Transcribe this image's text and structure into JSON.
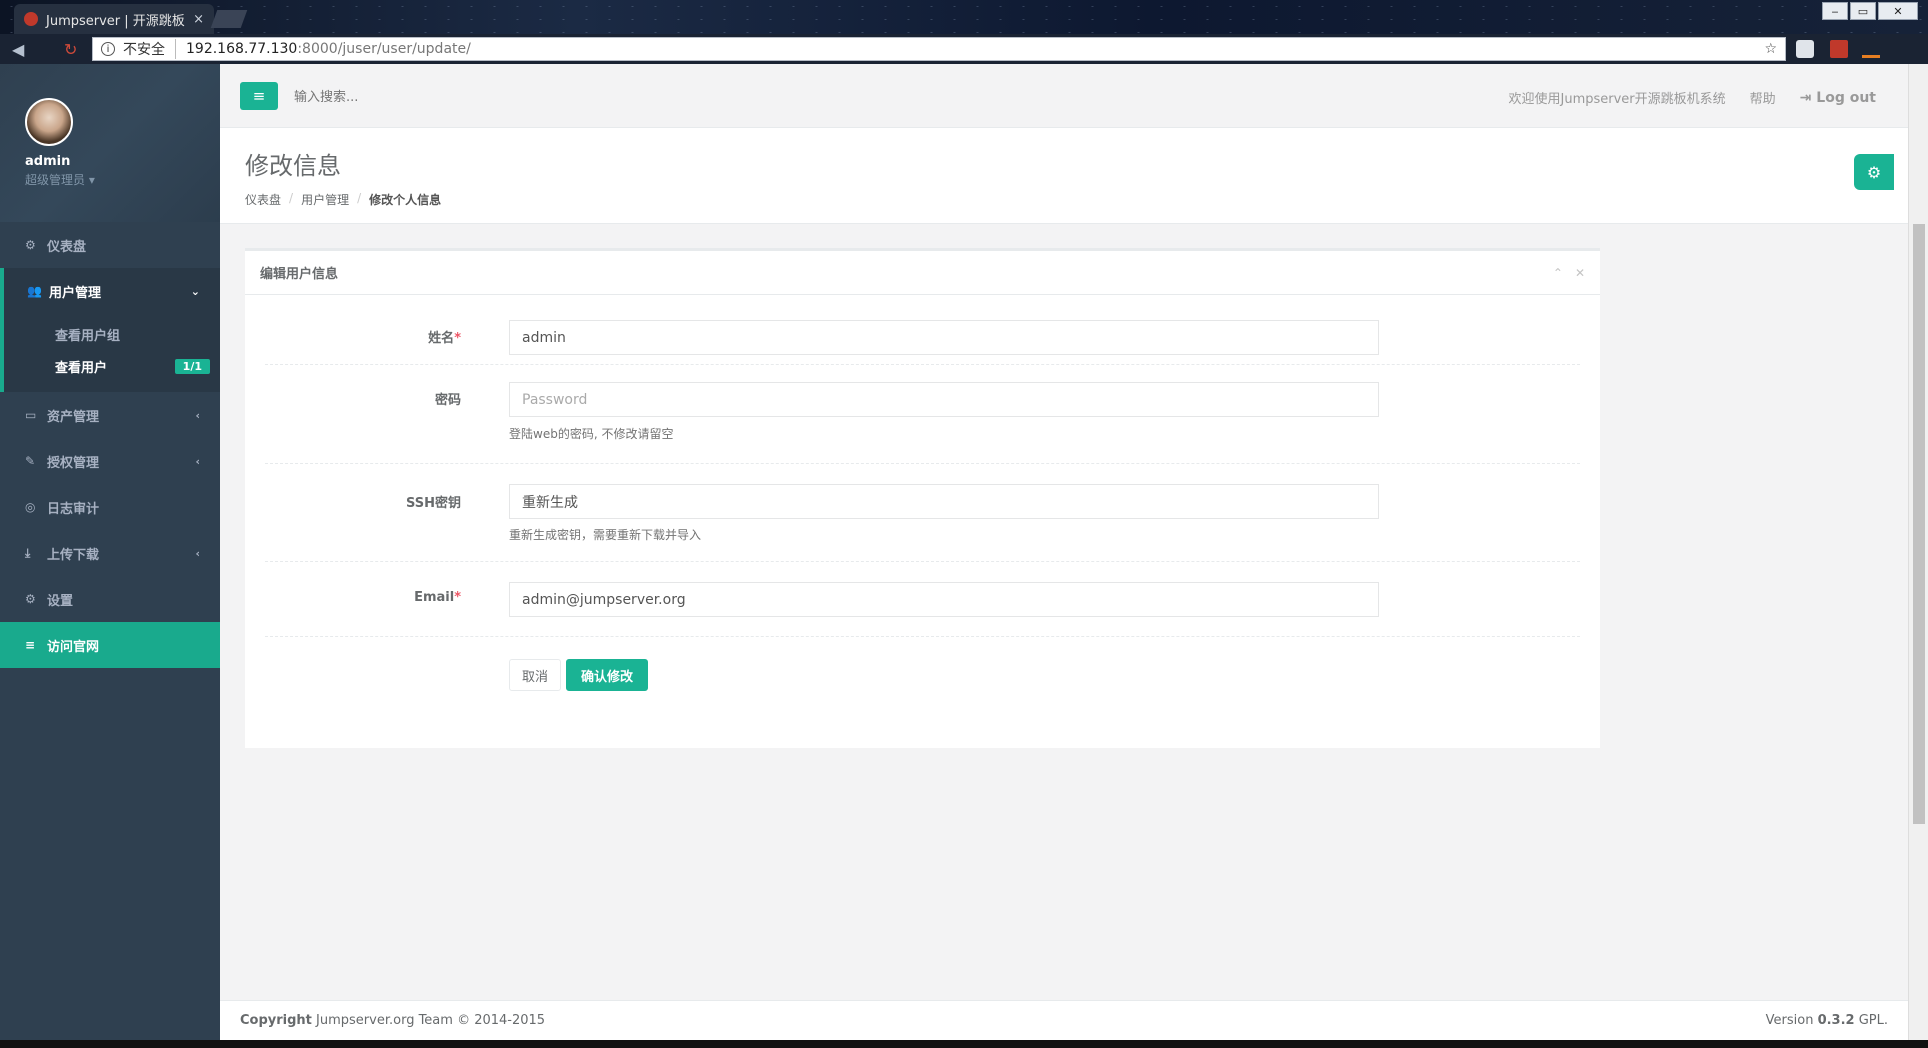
{
  "browser": {
    "tab_title": "Jumpserver | 开源跳板",
    "tab_close": "×",
    "insecure_label": "不安全",
    "url_host": "192.168.77.130",
    "url_path": ":8000/juser/user/update/",
    "win_min": "‒",
    "win_max": "▭",
    "win_close": "✕"
  },
  "sidebar": {
    "username": "admin",
    "role": "超级管理员 ▾",
    "items": [
      {
        "label": "仪表盘",
        "icon": "⚙"
      },
      {
        "label": "用户管理",
        "icon": "👥",
        "arrow": "⌄"
      },
      {
        "label": "资产管理",
        "icon": "▭",
        "arrow": "‹"
      },
      {
        "label": "授权管理",
        "icon": "✎",
        "arrow": "‹"
      },
      {
        "label": "日志审计",
        "icon": "◎"
      },
      {
        "label": "上传下载",
        "icon": "⤓",
        "arrow": "‹"
      },
      {
        "label": "设置",
        "icon": "⚙"
      },
      {
        "label": "访问官网",
        "icon": "≡"
      }
    ],
    "subitems": [
      {
        "label": "查看用户组"
      },
      {
        "label": "查看用户",
        "badge": "1/1"
      }
    ]
  },
  "topbar": {
    "menu_icon": "≡",
    "search_placeholder": "输入搜索...",
    "welcome": "欢迎使用Jumpserver开源跳板机系统",
    "help": "帮助",
    "logout": "Log out",
    "logout_icon": "⇥"
  },
  "page": {
    "title": "修改信息",
    "breadcrumb": [
      "仪表盘",
      "用户管理",
      "修改个人信息"
    ],
    "breadcrumb_sep": "/",
    "gear_icon": "⚙"
  },
  "form": {
    "panel_title": "编辑用户信息",
    "collapse_icon": "⌃",
    "close_icon": "✕",
    "name_label": "姓名",
    "name_value": "admin",
    "required_mark": "*",
    "password_label": "密码",
    "password_placeholder": "Password",
    "password_help": "登陆web的密码, 不修改请留空",
    "ssh_label": "SSH密钥",
    "ssh_value": "重新生成",
    "ssh_help": "重新生成密钥，需要重新下载并导入",
    "email_label": "Email",
    "email_value": "admin@jumpserver.org",
    "cancel": "取消",
    "submit": "确认修改"
  },
  "footer": {
    "copyright_strong": "Copyright",
    "copyright_rest": " Jumpserver.org Team © 2014-2015",
    "version_prefix": "Version ",
    "version": "0.3.2",
    "version_suffix": " GPL."
  },
  "colors": {
    "sidebar": "#2f4050",
    "accent": "#1ab394",
    "background": "#f3f3f4"
  }
}
